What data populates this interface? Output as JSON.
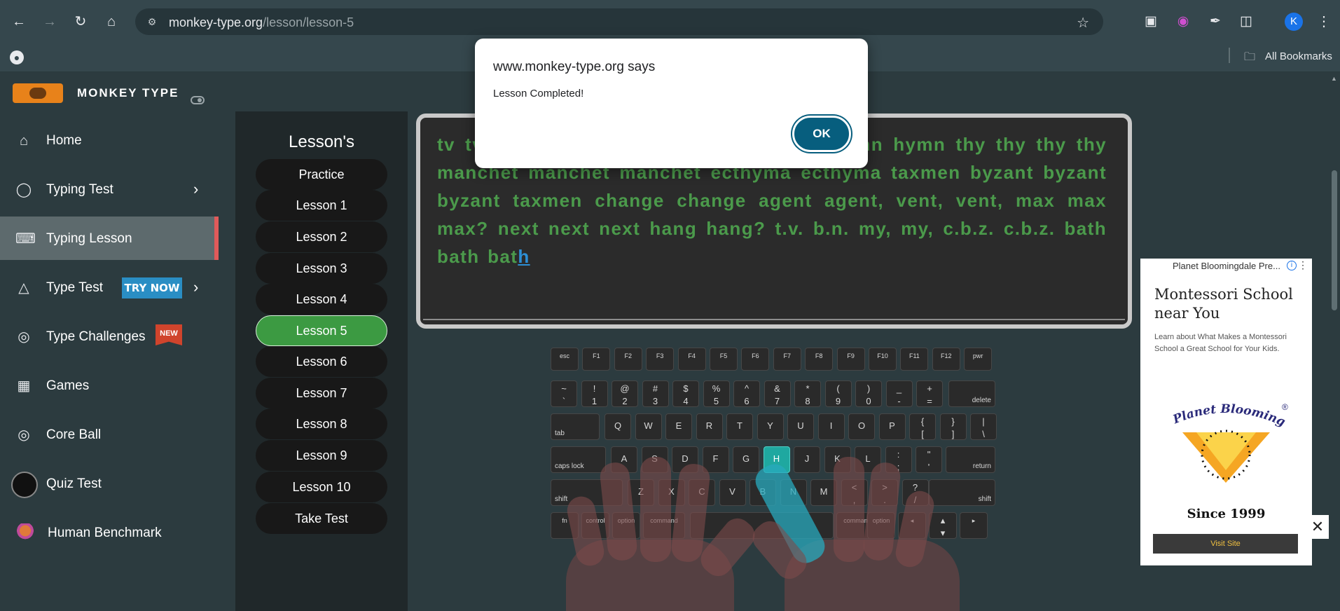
{
  "browser": {
    "url_domain": "monkey-type.org",
    "url_path": "/lesson/lesson-5",
    "avatar_letter": "K",
    "bookmarks_label": "All Bookmarks",
    "icons": [
      "back-arrow-icon",
      "forward-arrow-icon",
      "reload-icon",
      "home-icon",
      "site-settings-icon",
      "star-icon",
      "camera-icon",
      "color-picker-icon",
      "eyedropper-icon",
      "puzzle-extensions-icon",
      "kebab-menu-icon",
      "globe-icon",
      "folder-icon"
    ]
  },
  "site": {
    "logo_text": "MONKEY TYPE"
  },
  "sidebar": {
    "items": [
      {
        "label": "Home",
        "icon": "home-icon"
      },
      {
        "label": "Typing Test",
        "icon": "github-cat-icon"
      },
      {
        "label": "Typing Lesson",
        "icon": "keyboard-icon"
      },
      {
        "label": "Type Test",
        "icon": "fox-icon",
        "badge": "TRY NOW"
      },
      {
        "label": "Type Challenges",
        "icon": "award-icon",
        "badge": "NEW"
      },
      {
        "label": "Games",
        "icon": "grid-icon"
      },
      {
        "label": "Core Ball",
        "icon": "target-icon"
      },
      {
        "label": "Quiz Test",
        "icon": "quiz-avatar"
      },
      {
        "label": "Human Benchmark",
        "icon": "brain-icon"
      }
    ]
  },
  "lessons": {
    "title": "Lesson's",
    "items": [
      "Practice",
      "Lesson 1",
      "Lesson 2",
      "Lesson 3",
      "Lesson 4",
      "Lesson 5",
      "Lesson 6",
      "Lesson 7",
      "Lesson 8",
      "Lesson 9",
      "Lesson 10",
      "Take Test"
    ],
    "selected": "Lesson 5"
  },
  "typing": {
    "text": "tv tv thy myth myth myth hymn hymn hymn hymn thy thy thy thy manchet manchet manchet ecthyma ecthyma taxmen byzant byzant byzant taxmen change change agent agent, vent, vent, max max max? next next next hang hang? t.v. b.n. my, my, c.b.z. c.b.z. bath bath bat",
    "current_char": "h"
  },
  "keyboard": {
    "highlighted_key": "H",
    "row0": [
      "esc",
      "F1",
      "F2",
      "F3",
      "F4",
      "F5",
      "F6",
      "F7",
      "F8",
      "F9",
      "F10",
      "F11",
      "F12",
      "pwr"
    ],
    "row1": [
      [
        "~",
        "`"
      ],
      [
        "!",
        "1"
      ],
      [
        "@",
        "2"
      ],
      [
        "#",
        "3"
      ],
      [
        "$",
        "4"
      ],
      [
        "%",
        "5"
      ],
      [
        "^",
        "6"
      ],
      [
        "&",
        "7"
      ],
      [
        "*",
        "8"
      ],
      [
        "(",
        "9"
      ],
      [
        ")",
        "0"
      ],
      [
        "_",
        "-"
      ],
      [
        "+",
        "="
      ]
    ],
    "row1_end": "delete",
    "row2_start": "tab",
    "row2": [
      "Q",
      "W",
      "E",
      "R",
      "T",
      "Y",
      "U",
      "I",
      "O",
      "P",
      "{ [",
      "} ]",
      "| \\"
    ],
    "row3_start": "caps lock",
    "row3": [
      "A",
      "S",
      "D",
      "F",
      "G",
      "H",
      "J",
      "K",
      "L",
      ": ;",
      "\" '"
    ],
    "row3_end": "return",
    "row4_start": "shift",
    "row4": [
      "Z",
      "X",
      "C",
      "V",
      "B",
      "N",
      "M",
      "< ,",
      "> .",
      "? /"
    ],
    "row4_end": "shift",
    "row5": [
      "fn",
      "control",
      "option",
      "command",
      "",
      "command",
      "option",
      "◂",
      "▴ ▾",
      "▸"
    ]
  },
  "ad": {
    "sponsor": "Planet Bloomingdale Pre...",
    "title": "Montessori School near You",
    "description": "Learn about What Makes a Montessori School a Great School for Your Kids.",
    "brand_logo_text": "Planet Bloomingdale",
    "since": "Since 1999",
    "cta": "Visit Site",
    "close": "✕"
  },
  "dialog": {
    "title": "www.monkey-type.org says",
    "message": "Lesson Completed!",
    "ok_label": "OK"
  }
}
